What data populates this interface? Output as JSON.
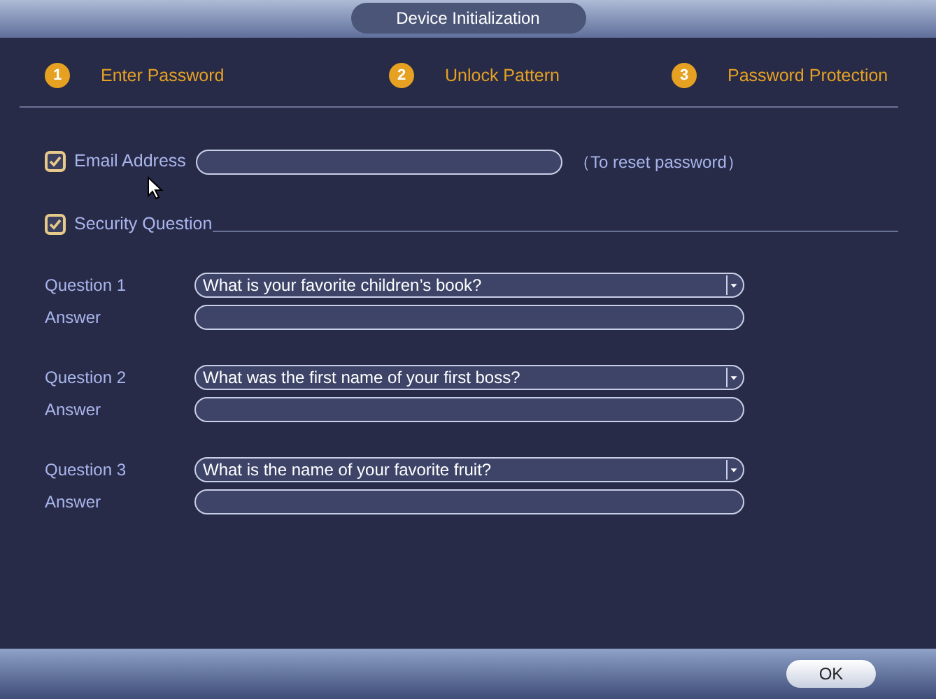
{
  "window": {
    "title": "Device Initialization"
  },
  "steps": [
    {
      "number": "1",
      "label": "Enter Password"
    },
    {
      "number": "2",
      "label": "Unlock Pattern"
    },
    {
      "number": "3",
      "label": "Password Protection"
    }
  ],
  "email": {
    "label": "Email Address",
    "checked": true,
    "note": "（To reset password）"
  },
  "security_question": {
    "label": "Security Question",
    "checked": true
  },
  "questions": [
    {
      "label": "Question 1",
      "value": "What is your favorite children’s book?",
      "answer_label": "Answer"
    },
    {
      "label": "Question 2",
      "value": "What was the first name of your first boss?",
      "answer_label": "Answer"
    },
    {
      "label": "Question 3",
      "value": "What is the name of your favorite fruit?",
      "answer_label": "Answer"
    }
  ],
  "buttons": [
    "OK"
  ]
}
